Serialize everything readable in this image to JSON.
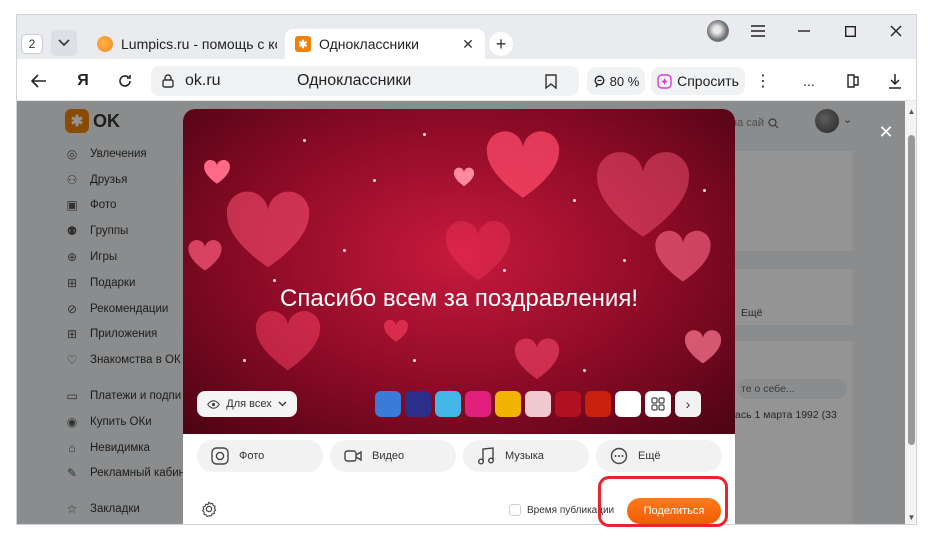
{
  "browser": {
    "tab_count": "2",
    "tabs": [
      {
        "title": "Lumpics.ru - помощь с ко",
        "active": false
      },
      {
        "title": "Одноклассники",
        "active": true
      }
    ],
    "address": {
      "domain": "ok.ru",
      "page_title": "Одноклассники"
    },
    "zoom": "80 %",
    "ask_label": "Спросить",
    "more_label": "..."
  },
  "site": {
    "logo_text": "OK",
    "search_placeholder": "на сай",
    "sidebar": [
      {
        "label": "Увлечения",
        "icon": "hobby-icon"
      },
      {
        "label": "Друзья",
        "icon": "friends-icon"
      },
      {
        "label": "Фото",
        "icon": "photo-icon"
      },
      {
        "label": "Группы",
        "icon": "groups-icon"
      },
      {
        "label": "Игры",
        "icon": "games-icon"
      },
      {
        "label": "Подарки",
        "icon": "gift-icon"
      },
      {
        "label": "Рекомендации",
        "icon": "compass-icon"
      },
      {
        "label": "Приложения",
        "icon": "apps-icon"
      },
      {
        "label": "Знакомства в ОК",
        "icon": "dating-icon"
      },
      {
        "label": "Платежи и подпи",
        "icon": "card-icon"
      },
      {
        "label": "Купить ОКи",
        "icon": "coin-icon"
      },
      {
        "label": "Невидимка",
        "icon": "invisible-icon"
      },
      {
        "label": "Рекламный кабин",
        "icon": "ads-icon"
      },
      {
        "label": "Закладки",
        "icon": "bookmark-icon"
      }
    ],
    "right_ghost": {
      "more": "Ещё",
      "about_placeholder": "те о себе...",
      "birthday": "ась 1 марта 1992 (33"
    }
  },
  "composer": {
    "post_text": "Спасибо всем за поздравления!",
    "audience": "Для всех",
    "background_swatches": [
      "#3b7bd8",
      "#2b2f8a",
      "#43b7e8",
      "#e0207a",
      "#f2b200",
      "#f0c8d0",
      "#b01020",
      "#c8220e",
      "#ffffff"
    ],
    "media": [
      {
        "label": "Фото",
        "icon": "camera-icon"
      },
      {
        "label": "Видео",
        "icon": "video-icon"
      },
      {
        "label": "Музыка",
        "icon": "music-icon"
      },
      {
        "label": "Ещё",
        "icon": "more-icon"
      }
    ],
    "publish_time_label": "Время публикации",
    "share_label": "Поделиться"
  }
}
